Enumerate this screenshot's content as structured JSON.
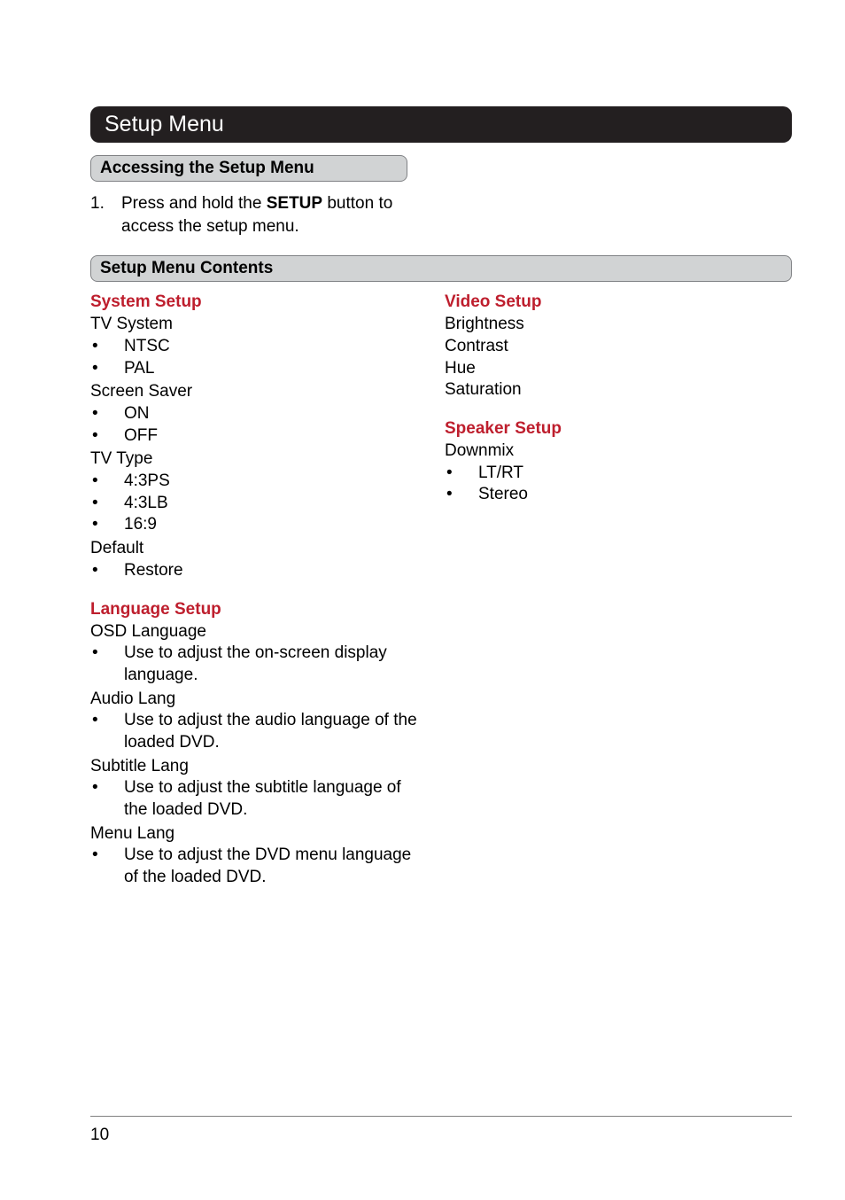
{
  "page_number": "10",
  "title": "Setup Menu",
  "sub1": {
    "heading": "Accessing the Setup Menu",
    "item_num": "1.",
    "item_text_pre": "Press and hold the ",
    "item_text_bold": "SETUP",
    "item_text_post": " button to access the setup menu."
  },
  "sub2": {
    "heading": "Setup Menu Contents"
  },
  "system_setup": {
    "heading": "System Setup",
    "tv_system": "TV System",
    "ntsc": "NTSC",
    "pal": "PAL",
    "screen_saver": "Screen Saver",
    "on": "ON",
    "off": "OFF",
    "tv_type": "TV Type",
    "r43ps": "4:3PS",
    "r43lb": "4:3LB",
    "r169": "16:9",
    "default": "Default",
    "restore": "Restore"
  },
  "language_setup": {
    "heading": "Language Setup",
    "osd": "OSD Language",
    "osd_desc": "Use to adjust the on-screen display language.",
    "audio": "Audio Lang",
    "audio_desc": "Use to adjust the audio language of the loaded DVD.",
    "subtitle": "Subtitle Lang",
    "subtitle_desc": "Use to adjust the subtitle language of the loaded DVD.",
    "menu": "Menu Lang",
    "menu_desc": "Use to adjust the DVD menu language of the loaded DVD."
  },
  "video_setup": {
    "heading": "Video Setup",
    "brightness": "Brightness",
    "contrast": "Contrast",
    "hue": "Hue",
    "saturation": "Saturation"
  },
  "speaker_setup": {
    "heading": "Speaker Setup",
    "downmix": "Downmix",
    "ltrt": "LT/RT",
    "stereo": "Stereo"
  },
  "bullet": "•"
}
